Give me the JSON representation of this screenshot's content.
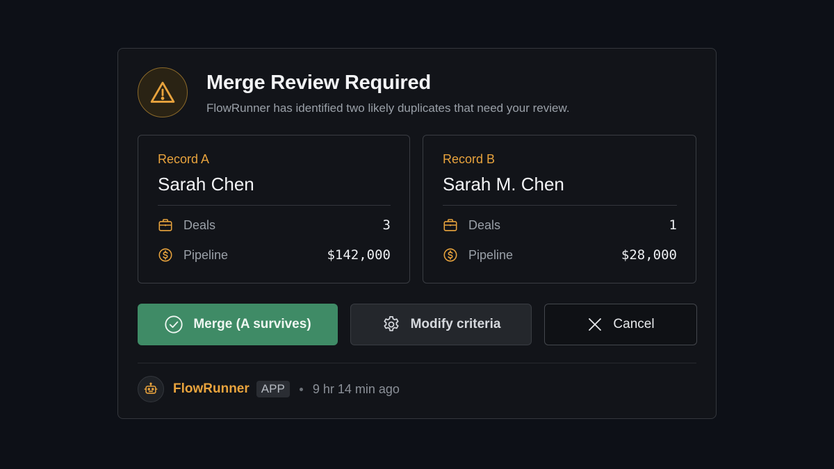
{
  "dialog": {
    "title": "Merge Review Required",
    "subtitle": "FlowRunner has identified two likely duplicates that need your review.",
    "icon": "warning-triangle-icon"
  },
  "records": [
    {
      "label": "Record A",
      "name": "Sarah Chen",
      "deals_label": "Deals",
      "deals_value": "3",
      "pipeline_label": "Pipeline",
      "pipeline_value": "$142,000"
    },
    {
      "label": "Record B",
      "name": "Sarah M. Chen",
      "deals_label": "Deals",
      "deals_value": "1",
      "pipeline_label": "Pipeline",
      "pipeline_value": "$28,000"
    }
  ],
  "actions": {
    "merge_label": "Merge (A survives)",
    "modify_label": "Modify criteria",
    "cancel_label": "Cancel"
  },
  "footer": {
    "app_name": "FlowRunner",
    "app_badge": "APP",
    "timestamp": "9 hr 14 min ago"
  },
  "colors": {
    "accent": "#e8a33d",
    "merge_green": "#3f8b66",
    "background": "#0d1017",
    "card": "#121419"
  }
}
